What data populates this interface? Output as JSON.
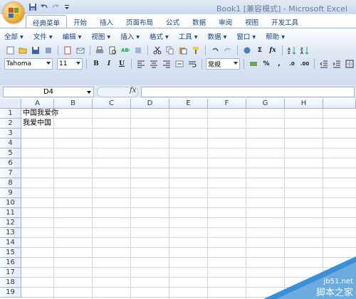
{
  "window": {
    "title": "Book1  [兼容模式] - Microsoft Excel"
  },
  "quick_access": {
    "items": [
      "save-icon",
      "undo-icon",
      "redo-icon",
      "customize-icon"
    ]
  },
  "ribbon_tabs": [
    "经典菜单",
    "开始",
    "插入",
    "页面布局",
    "公式",
    "数据",
    "审阅",
    "视图",
    "开发工具"
  ],
  "menubar": [
    "全部 ▾",
    "文件 ▾",
    "编辑 ▾",
    "视图 ▾",
    "插入 ▾",
    "格式 ▾",
    "工具 ▾",
    "数据 ▾",
    "窗口 ▾",
    "帮助 ▾"
  ],
  "format_bar": {
    "font_name": "Tahoma",
    "font_size": "11",
    "bold": "B",
    "italic": "I",
    "underline": "U",
    "number_format": "常规",
    "percent": "%",
    "comma": ","
  },
  "formula_bar": {
    "name_box": "D4",
    "fx_label": "fx",
    "formula": ""
  },
  "sheet": {
    "columns": [
      "A",
      "B",
      "C",
      "D",
      "E",
      "F",
      "G",
      "H"
    ],
    "rows": [
      "1",
      "2",
      "3",
      "4",
      "5",
      "6",
      "7",
      "8",
      "9",
      "10",
      "11",
      "12",
      "13",
      "14",
      "15",
      "16",
      "17",
      "18",
      "19"
    ],
    "cells": {
      "A1": "中国我爱你",
      "A2": "我爱中国"
    }
  },
  "watermark": {
    "line1": "jb51.net",
    "line2": "脚本之家"
  },
  "colors": {
    "accent": "#15428b",
    "ribbon_bg": "#dfe8f5",
    "grid_line": "#d0d7e5",
    "watermark_blue": "#3a8fd6"
  }
}
